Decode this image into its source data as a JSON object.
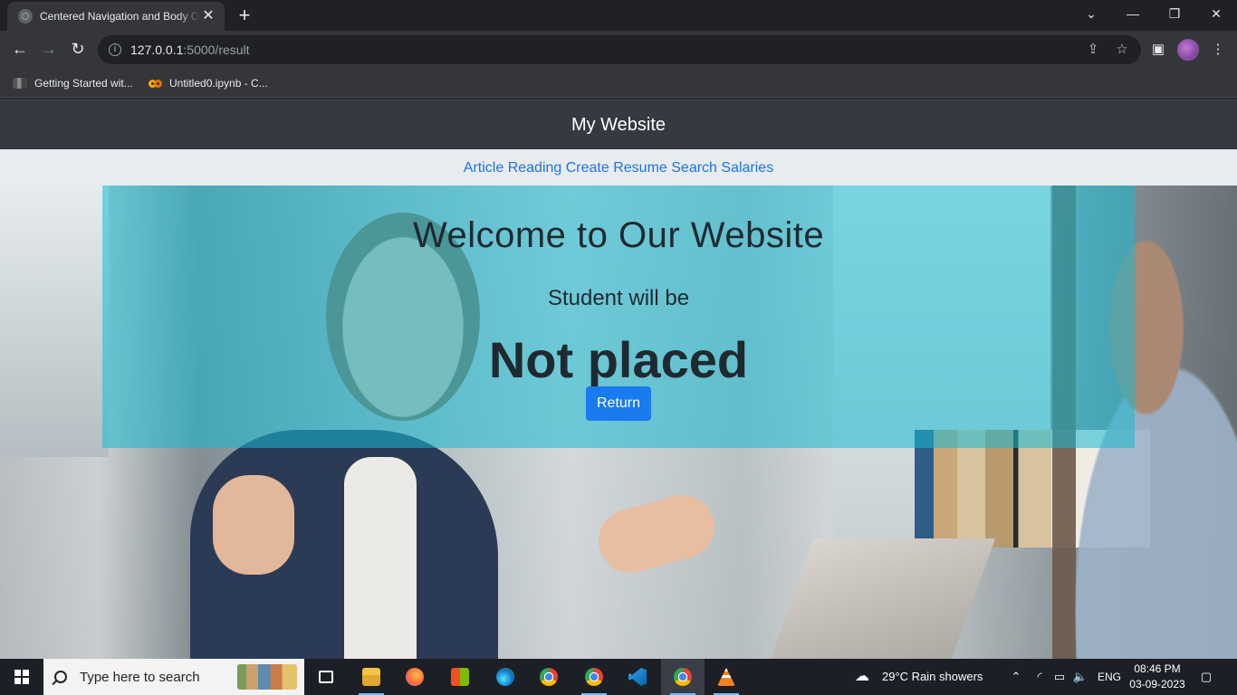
{
  "browser": {
    "tab_title": "Centered Navigation and Body Content",
    "tab_close": "✕",
    "new_tab": "+",
    "url_host": "127.0.0.1",
    "url_path": ":5000/result",
    "bookmarks": [
      {
        "label": "Getting Started wit..."
      },
      {
        "label": "Untitled0.ipynb - C..."
      }
    ]
  },
  "page": {
    "site_title": "My Website",
    "nav": [
      "Article Reading",
      "Create Resume",
      "Search Salaries"
    ],
    "welcome": "Welcome to Our Website",
    "student_line": "Student will be",
    "result": "Not placed",
    "return_label": "Return"
  },
  "taskbar": {
    "search_placeholder": "Type here to search",
    "weather": "29°C  Rain showers",
    "language": "ENG",
    "time": "08:46 PM",
    "date": "03-09-2023"
  },
  "colors": {
    "overlay": "#17b9d2",
    "button": "#1a7af0",
    "nav_link": "#1a73e8",
    "header_bg": "#343a40"
  }
}
